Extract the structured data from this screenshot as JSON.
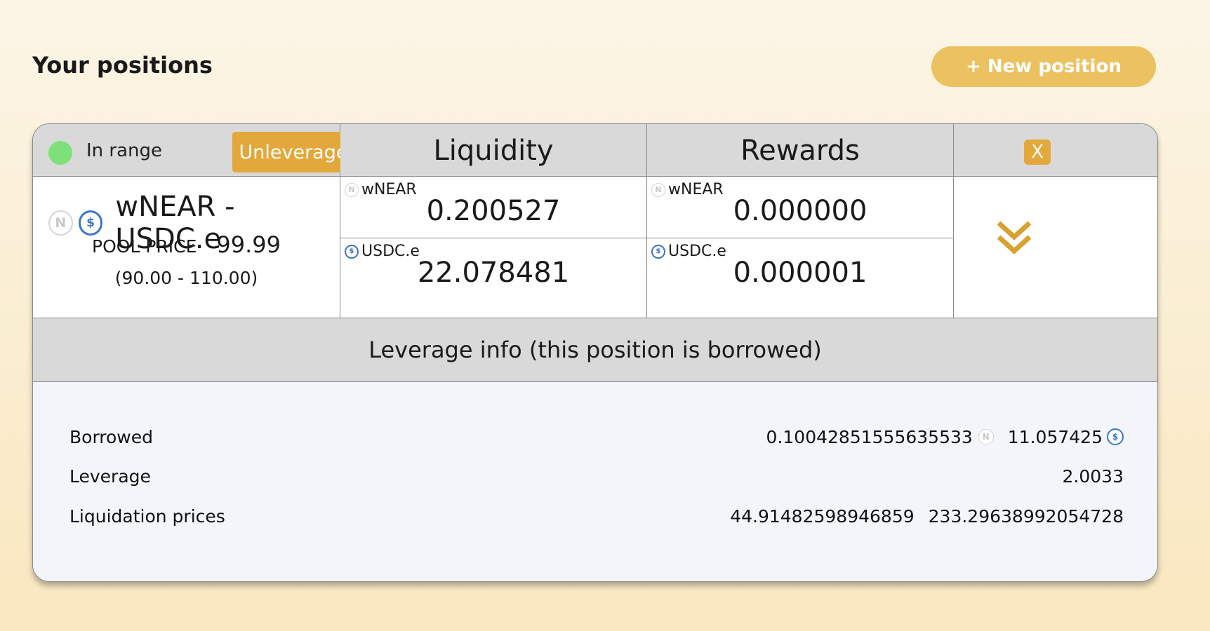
{
  "page": {
    "title": "Your positions",
    "new_position_label": "+ New position"
  },
  "position": {
    "status": "In range",
    "status_color": "#7fe07a",
    "unleverage_label": "Unleverage",
    "close_label": "X",
    "pair": "wNEAR - USDC.e",
    "pool_price_label": "POOL PRICE",
    "pool_price": "99.99",
    "range": "(90.00 - 110.00)",
    "liquidity": {
      "title": "Liquidity",
      "token_a": {
        "name": "wNEAR",
        "icon": "near-icon",
        "amount": "0.200527"
      },
      "token_b": {
        "name": "USDC.e",
        "icon": "usdc-icon",
        "amount": "22.078481"
      }
    },
    "rewards": {
      "title": "Rewards",
      "token_a": {
        "name": "wNEAR",
        "icon": "near-icon",
        "amount": "0.000000"
      },
      "token_b": {
        "name": "USDC.e",
        "icon": "usdc-icon",
        "amount": "0.000001"
      }
    },
    "expand_icon": "double-chevron-down-icon"
  },
  "leverage_info": {
    "title": "Leverage info (this position is borrowed)",
    "borrowed_label": "Borrowed",
    "borrowed_a": "0.10042851555635533",
    "borrowed_b": "11.057425",
    "leverage_label": "Leverage",
    "leverage": "2.0033",
    "liquidation_label": "Liquidation prices",
    "liquidation_low": "44.91482598946859",
    "liquidation_high": "233.29638992054728"
  },
  "colors": {
    "accent": "#e3a83c",
    "button_primary": "#ecc261",
    "header_gray": "#d9d9d9",
    "usdc_blue": "#3d74c8"
  }
}
